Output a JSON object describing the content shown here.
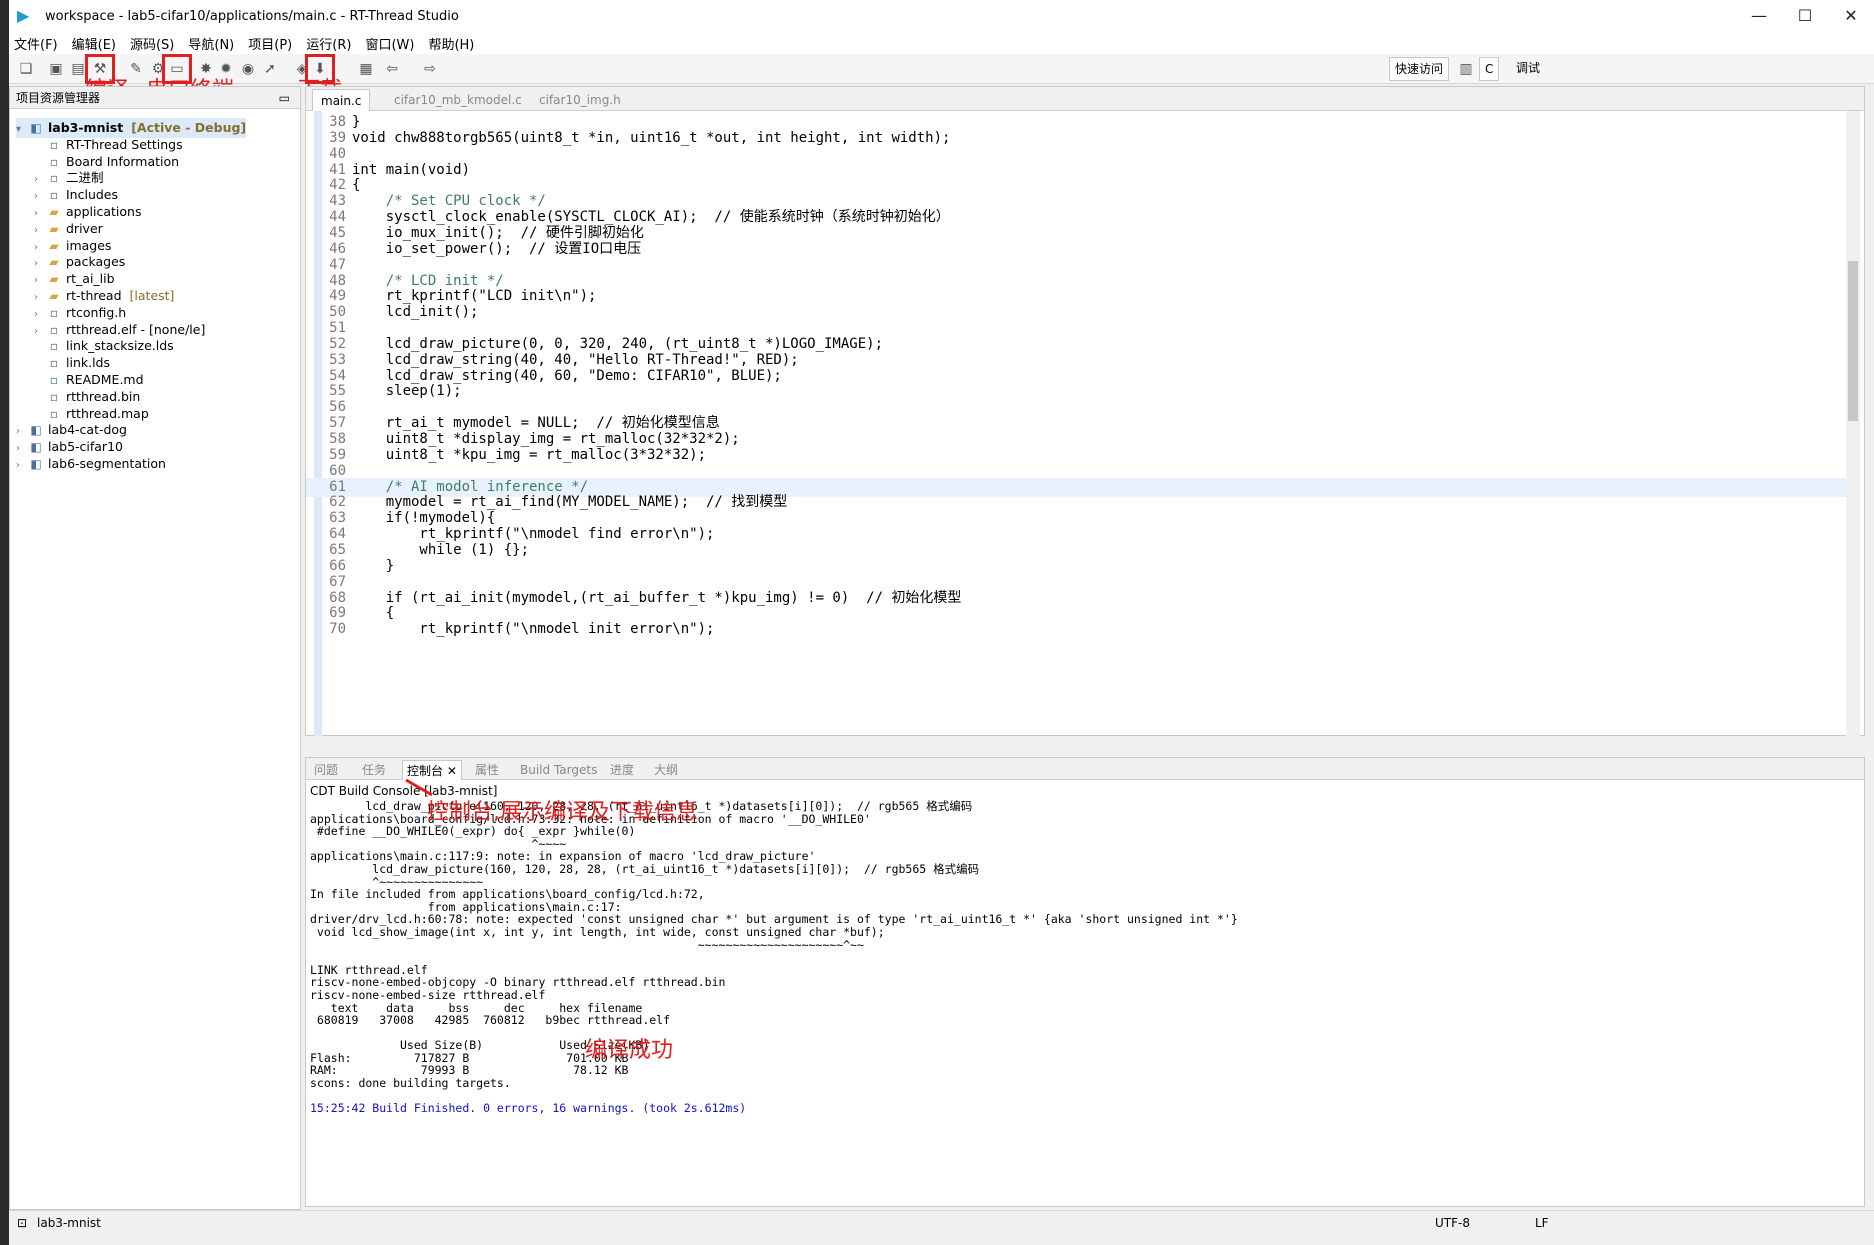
{
  "window": {
    "title": "workspace - lab5-cifar10/applications/main.c - RT-Thread Studio",
    "controls": [
      "—",
      "☐",
      "✕"
    ]
  },
  "menu": [
    "文件(F)",
    "编辑(E)",
    "源码(S)",
    "导航(N)",
    "项目(P)",
    "运行(R)",
    "窗口(W)",
    "帮助(H)"
  ],
  "toolbar": {
    "quick_access": "快速访问",
    "perspective_c": "C",
    "perspective_debug": "调试"
  },
  "annotations": {
    "compile": "编译",
    "serial": "串口终端",
    "download": "下载",
    "console_note": "控制台,展示编译及下载信息",
    "build_success": "编译成功"
  },
  "explorer": {
    "tab_label": "项目资源管理器",
    "items": [
      {
        "label": "lab3-mnist",
        "decoration": "[Active - Debug]",
        "icon": "project-icon",
        "arrow": "v",
        "indent": 0,
        "active": true
      },
      {
        "label": "RT-Thread Settings",
        "decoration": "",
        "icon": "rt-settings-icon",
        "arrow": "",
        "indent": 1
      },
      {
        "label": "Board Information",
        "decoration": "",
        "icon": "board-icon",
        "arrow": "",
        "indent": 1
      },
      {
        "label": "二进制",
        "decoration": "",
        "icon": "binary-icon",
        "arrow": ">",
        "indent": 1
      },
      {
        "label": "Includes",
        "decoration": "",
        "icon": "includes-icon",
        "arrow": ">",
        "indent": 1
      },
      {
        "label": "applications",
        "decoration": "",
        "icon": "folder-icon",
        "arrow": ">",
        "indent": 1
      },
      {
        "label": "driver",
        "decoration": "",
        "icon": "folder-icon",
        "arrow": ">",
        "indent": 1
      },
      {
        "label": "images",
        "decoration": "",
        "icon": "folder-icon",
        "arrow": ">",
        "indent": 1
      },
      {
        "label": "packages",
        "decoration": "",
        "icon": "folder-icon",
        "arrow": ">",
        "indent": 1
      },
      {
        "label": "rt_ai_lib",
        "decoration": "",
        "icon": "folder-icon",
        "arrow": ">",
        "indent": 1
      },
      {
        "label": "rt-thread",
        "decoration": "[latest]",
        "icon": "folder-icon",
        "arrow": ">",
        "indent": 1
      },
      {
        "label": "rtconfig.h",
        "decoration": "",
        "icon": "header-file-icon",
        "arrow": ">",
        "indent": 1
      },
      {
        "label": "rtthread.elf - [none/le]",
        "decoration": "",
        "icon": "elf-icon",
        "arrow": ">",
        "indent": 1
      },
      {
        "label": "link_stacksize.lds",
        "decoration": "",
        "icon": "file-icon",
        "arrow": "",
        "indent": 1
      },
      {
        "label": "link.lds",
        "decoration": "",
        "icon": "file-icon",
        "arrow": "",
        "indent": 1
      },
      {
        "label": "README.md",
        "decoration": "",
        "icon": "md-file-icon",
        "arrow": "",
        "indent": 1
      },
      {
        "label": "rtthread.bin",
        "decoration": "",
        "icon": "file-icon",
        "arrow": "",
        "indent": 1
      },
      {
        "label": "rtthread.map",
        "decoration": "",
        "icon": "map-file-icon",
        "arrow": "",
        "indent": 1
      },
      {
        "label": "lab4-cat-dog",
        "decoration": "",
        "icon": "project-icon",
        "arrow": ">",
        "indent": 0
      },
      {
        "label": "lab5-cifar10",
        "decoration": "",
        "icon": "project-icon",
        "arrow": ">",
        "indent": 0
      },
      {
        "label": "lab6-segmentation",
        "decoration": "",
        "icon": "project-icon",
        "arrow": ">",
        "indent": 0
      }
    ]
  },
  "editor": {
    "tabs": [
      "main.c",
      "cifar10_mb_kmodel.c",
      "cifar10_img.h"
    ],
    "lines": [
      {
        "no": "38",
        "text": "}"
      },
      {
        "no": "39",
        "text": "void chw888torgb565(uint8_t *in, uint16_t *out, int height, int width);"
      },
      {
        "no": "40",
        "text": ""
      },
      {
        "no": "41",
        "text": "int main(void)"
      },
      {
        "no": "42",
        "text": "{"
      },
      {
        "no": "43",
        "text": "    /* Set CPU clock */"
      },
      {
        "no": "44",
        "text": "    sysctl_clock_enable(SYSCTL_CLOCK_AI);  // 使能系统时钟（系统时钟初始化）"
      },
      {
        "no": "45",
        "text": "    io_mux_init();  // 硬件引脚初始化"
      },
      {
        "no": "46",
        "text": "    io_set_power();  // 设置IO口电压"
      },
      {
        "no": "47",
        "text": ""
      },
      {
        "no": "48",
        "text": "    /* LCD init */"
      },
      {
        "no": "49",
        "text": "    rt_kprintf(\"LCD init\\n\");"
      },
      {
        "no": "50",
        "text": "    lcd_init();"
      },
      {
        "no": "51",
        "text": ""
      },
      {
        "no": "52",
        "text": "    lcd_draw_picture(0, 0, 320, 240, (rt_uint8_t *)LOGO_IMAGE);"
      },
      {
        "no": "53",
        "text": "    lcd_draw_string(40, 40, \"Hello RT-Thread!\", RED);"
      },
      {
        "no": "54",
        "text": "    lcd_draw_string(40, 60, \"Demo: CIFAR10\", BLUE);"
      },
      {
        "no": "55",
        "text": "    sleep(1);"
      },
      {
        "no": "56",
        "text": ""
      },
      {
        "no": "57",
        "text": "    rt_ai_t mymodel = NULL;  // 初始化模型信息"
      },
      {
        "no": "58",
        "text": "    uint8_t *display_img = rt_malloc(32*32*2);"
      },
      {
        "no": "59",
        "text": "    uint8_t *kpu_img = rt_malloc(3*32*32);"
      },
      {
        "no": "60",
        "text": ""
      },
      {
        "no": "61",
        "text": "    /* AI modol inference */"
      },
      {
        "no": "62",
        "text": "    mymodel = rt_ai_find(MY_MODEL_NAME);  // 找到模型"
      },
      {
        "no": "63",
        "text": "    if(!mymodel){"
      },
      {
        "no": "64",
        "text": "        rt_kprintf(\"\\nmodel find error\\n\");"
      },
      {
        "no": "65",
        "text": "        while (1) {};"
      },
      {
        "no": "66",
        "text": "    }"
      },
      {
        "no": "67",
        "text": ""
      },
      {
        "no": "68",
        "text": "    if (rt_ai_init(mymodel,(rt_ai_buffer_t *)kpu_img) != 0)  // 初始化模型"
      },
      {
        "no": "69",
        "text": "    {"
      },
      {
        "no": "70",
        "text": "        rt_kprintf(\"\\nmodel init error\\n\");"
      }
    ]
  },
  "console": {
    "tabs": [
      "问题",
      "任务",
      "控制台",
      "属性",
      "Build Targets",
      "进度",
      "大纲"
    ],
    "title": "CDT Build Console [lab3-mnist]",
    "lines": [
      {
        "text": "        lcd_draw_picture(160, 120, 28, 28, (rt_ai_uint16_t *)datasets[i][0]);  // rgb565 格式编码",
        "blue": false
      },
      {
        "text": "applications\\board_config/lcd.h:73:32: note: in definition of macro '__DO_WHILE0'",
        "blue": false
      },
      {
        "text": " #define __DO_WHILE0(_expr) do{ _expr }while(0)",
        "blue": false
      },
      {
        "text": "                                ^~~~~",
        "blue": false
      },
      {
        "text": "applications\\main.c:117:9: note: in expansion of macro 'lcd_draw_picture'",
        "blue": false
      },
      {
        "text": "         lcd_draw_picture(160, 120, 28, 28, (rt_ai_uint16_t *)datasets[i][0]);  // rgb565 格式编码",
        "blue": false
      },
      {
        "text": "         ^~~~~~~~~~~~~~~~",
        "blue": false
      },
      {
        "text": "In file included from applications\\board_config/lcd.h:72,",
        "blue": false
      },
      {
        "text": "                 from applications\\main.c:17:",
        "blue": false
      },
      {
        "text": "driver/drv_lcd.h:60:78: note: expected 'const unsigned char *' but argument is of type 'rt_ai_uint16_t *' {aka 'short unsigned int *'}",
        "blue": false
      },
      {
        "text": " void lcd_show_image(int x, int y, int length, int wide, const unsigned char *buf);",
        "blue": false
      },
      {
        "text": "                                                        ~~~~~~~~~~~~~~~~~~~~~^~~",
        "blue": false
      },
      {
        "text": "",
        "blue": false
      },
      {
        "text": "LINK rtthread.elf",
        "blue": false
      },
      {
        "text": "riscv-none-embed-objcopy -O binary rtthread.elf rtthread.bin",
        "blue": false
      },
      {
        "text": "riscv-none-embed-size rtthread.elf",
        "blue": false
      },
      {
        "text": "   text    data     bss     dec     hex filename",
        "blue": false
      },
      {
        "text": " 680819   37008   42985  760812   b9bec rtthread.elf",
        "blue": false
      },
      {
        "text": "",
        "blue": false
      },
      {
        "text": "             Used Size(B)           Used Size(KB)",
        "blue": false
      },
      {
        "text": "Flash:         717827 B              701.00 KB",
        "blue": false
      },
      {
        "text": "RAM:            79993 B               78.12 KB",
        "blue": false
      },
      {
        "text": "scons: done building targets.",
        "blue": false
      },
      {
        "text": "",
        "blue": false
      },
      {
        "text": "15:25:42 Build Finished. 0 errors, 16 warnings. (took 2s.612ms)",
        "blue": true
      }
    ]
  },
  "status": {
    "project": "lab3-mnist",
    "encoding": "UTF-8",
    "line_ending": "LF"
  },
  "colors": {
    "annotation_red": "#e02020",
    "keyword": "#7f0055",
    "comment": "#3f7f5f",
    "string": "#2a00ff",
    "macro_italic": "#0000c0"
  }
}
